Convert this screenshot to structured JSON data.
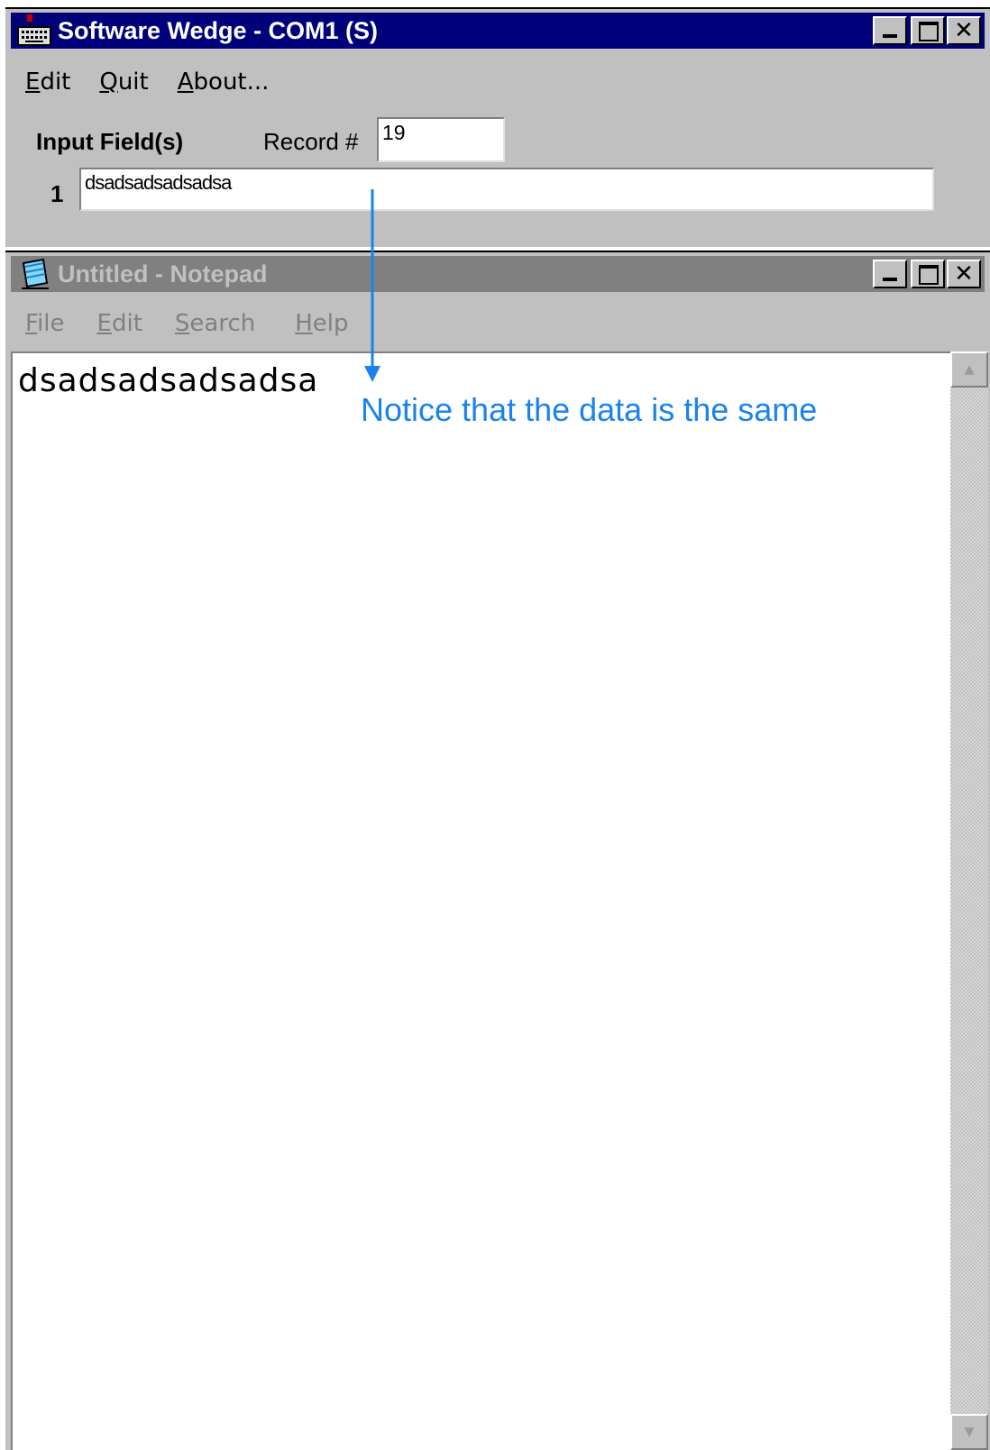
{
  "wedge": {
    "title": "Software Wedge - COM1 (S)",
    "app_icon": "keyboard-icon",
    "menu": [
      {
        "key": "E",
        "rest": "dit"
      },
      {
        "key": "Q",
        "rest": "uit"
      },
      {
        "key": "A",
        "rest": "bout..."
      }
    ],
    "input_fields_label": "Input Field(s)",
    "record_label": "Record #",
    "record_value": "19",
    "field_number": "1",
    "field_value": "dsadsadsadsadsa"
  },
  "notepad": {
    "title": "Untitled - Notepad",
    "app_icon": "notepad-icon",
    "menu": [
      {
        "key": "F",
        "rest": "ile"
      },
      {
        "key": "E",
        "rest": "dit"
      },
      {
        "key": "S",
        "rest": "earch"
      },
      {
        "key": "H",
        "rest": "elp"
      }
    ],
    "content": "dsadsadsadsadsa"
  },
  "annotation": {
    "text": "Notice that the data is the same",
    "color": "#1a82ee"
  },
  "colors": {
    "active_title": "#00007b",
    "inactive_title": "#808080",
    "window_face": "#c0c0c0"
  }
}
